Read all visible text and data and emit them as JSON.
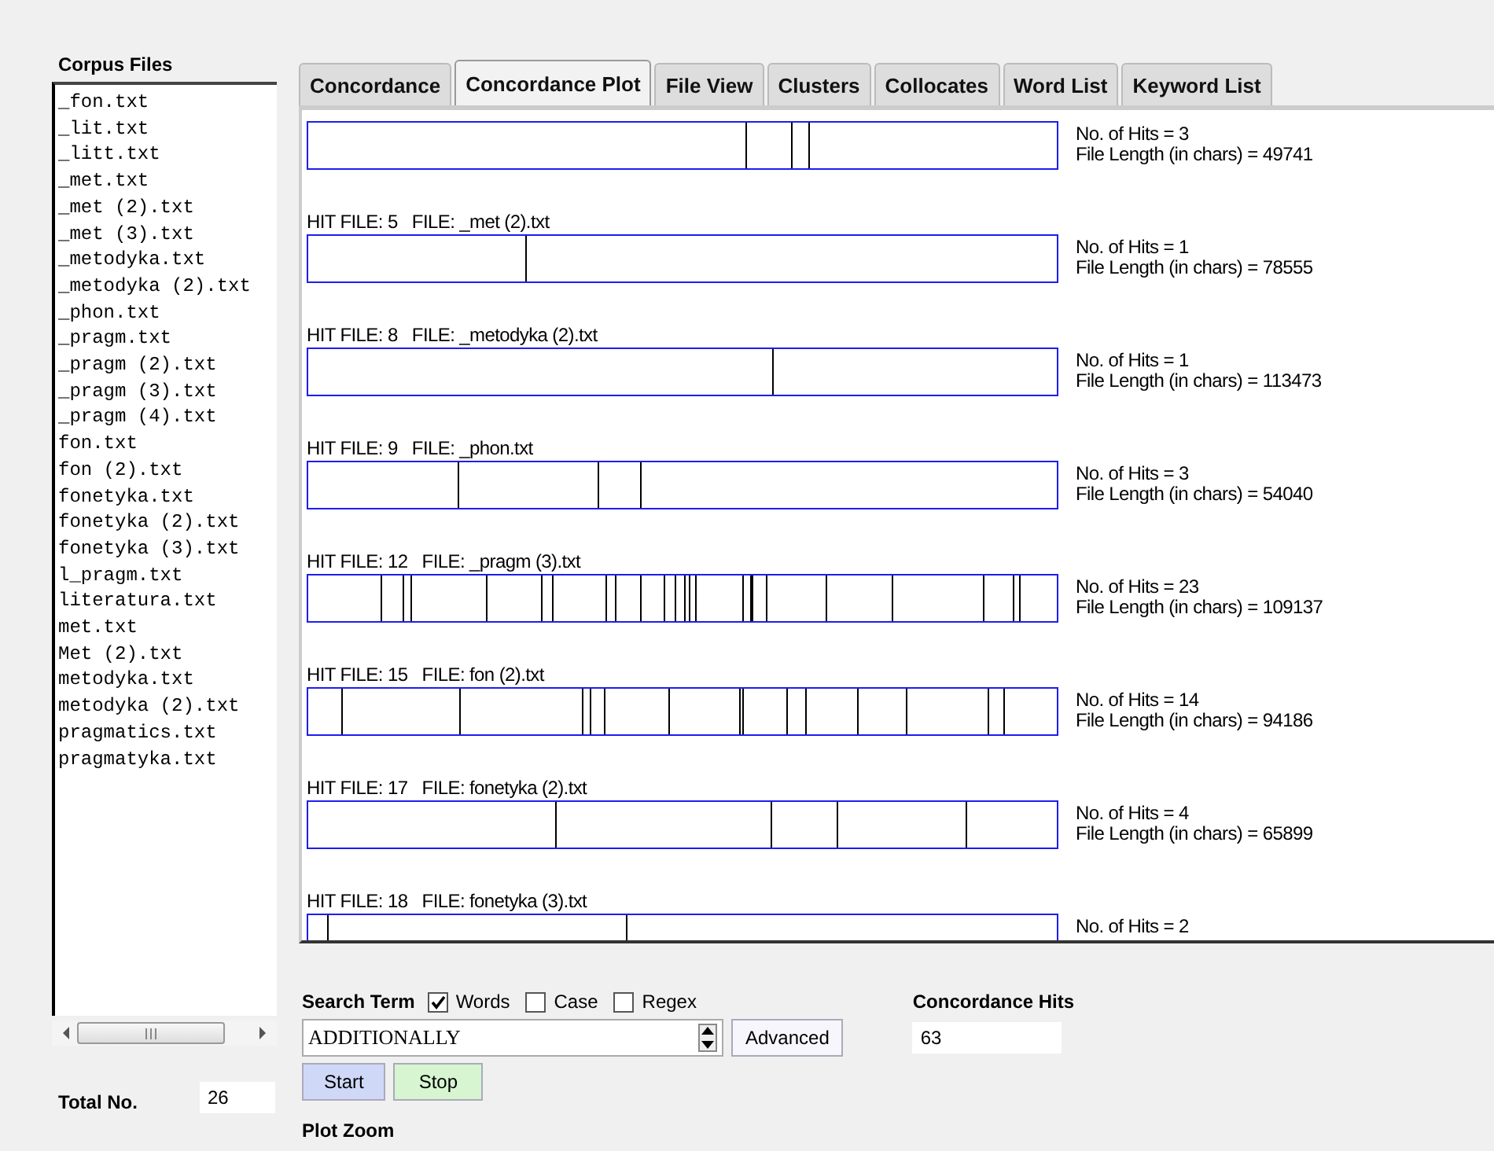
{
  "corpus_files": {
    "title": "Corpus Files",
    "files": [
      "_fon.txt",
      "_lit.txt",
      "_litt.txt",
      "_met.txt",
      "_met (2).txt",
      "_met (3).txt",
      "_metodyka.txt",
      "_metodyka (2).txt",
      "_phon.txt",
      "_pragm.txt",
      "_pragm (2).txt",
      "_pragm (3).txt",
      "_pragm (4).txt",
      "fon.txt",
      "fon (2).txt",
      "fonetyka.txt",
      "fonetyka (2).txt",
      "fonetyka (3).txt",
      "l_pragm.txt",
      "literatura.txt",
      "met.txt",
      "Met (2).txt",
      "metodyka.txt",
      "metodyka (2).txt",
      "pragmatics.txt",
      "pragmatyka.txt"
    ],
    "total_label": "Total No.",
    "total_value": "26"
  },
  "tabs": [
    {
      "label": "Concordance",
      "selected": false
    },
    {
      "label": "Concordance Plot",
      "selected": true
    },
    {
      "label": "File View",
      "selected": false
    },
    {
      "label": "Clusters",
      "selected": false
    },
    {
      "label": "Collocates",
      "selected": false
    },
    {
      "label": "Word List",
      "selected": false
    },
    {
      "label": "Keyword List",
      "selected": false
    }
  ],
  "plots": [
    {
      "hits": "No. of Hits = 3",
      "length": "File Length (in chars) = 49741"
    },
    {
      "label": "HIT FILE: 5   FILE: _met (2).txt",
      "hits": "No. of Hits = 1",
      "length": "File Length (in chars) = 78555"
    },
    {
      "label": "HIT FILE: 8   FILE: _metodyka (2).txt",
      "hits": "No. of Hits = 1",
      "length": "File Length (in chars) = 113473"
    },
    {
      "label": "HIT FILE: 9   FILE: _phon.txt",
      "hits": "No. of Hits = 3",
      "length": "File Length (in chars) = 54040"
    },
    {
      "label": "HIT FILE: 12   FILE: _pragm (3).txt",
      "hits": "No. of Hits = 23",
      "length": "File Length (in chars) = 109137"
    },
    {
      "label": "HIT FILE: 15   FILE: fon (2).txt",
      "hits": "No. of Hits = 14",
      "length": "File Length (in chars) = 94186"
    },
    {
      "label": "HIT FILE: 17   FILE: fonetyka (2).txt",
      "hits": "No. of Hits = 4",
      "length": "File Length (in chars) = 65899"
    },
    {
      "label": "HIT FILE: 18   FILE: fonetyka (3).txt",
      "hits": "No. of Hits = 2"
    }
  ],
  "search": {
    "label": "Search Term",
    "options": [
      {
        "label": "Words",
        "checked": true
      },
      {
        "label": "Case",
        "checked": false
      },
      {
        "label": "Regex",
        "checked": false
      }
    ],
    "value": "ADDITIONALLY",
    "advanced": "Advanced",
    "start": "Start",
    "stop": "Stop",
    "plot_zoom": "Plot Zoom"
  },
  "hits": {
    "label": "Concordance Hits",
    "value": "63"
  }
}
